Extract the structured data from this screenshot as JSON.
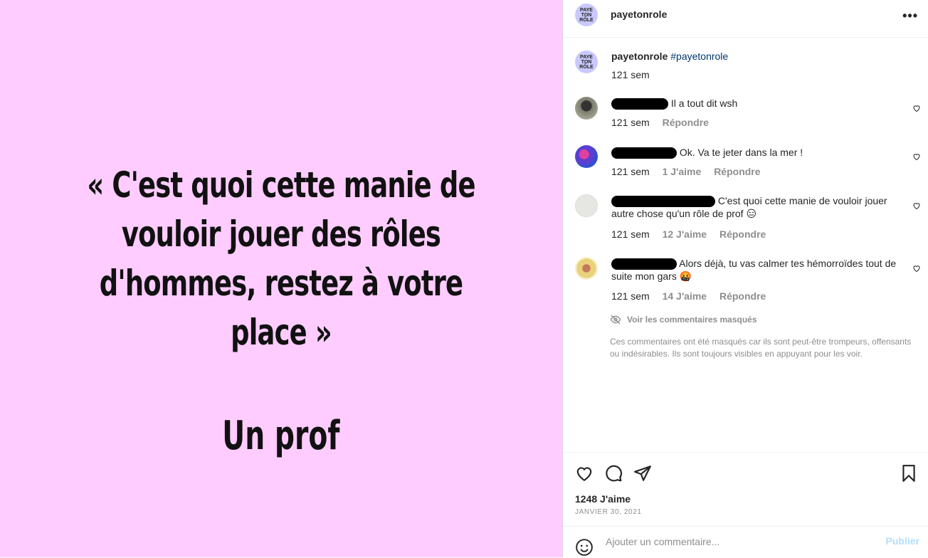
{
  "post": {
    "quote": "« C'est quoi cette manie de vouloir jouer des rôles d'hommes, restez à votre place »",
    "author": "Un prof"
  },
  "header": {
    "username": "payetonrole",
    "more_label": "•••",
    "logo_text": "PAYE TON RÔLE"
  },
  "caption": {
    "username": "payetonrole",
    "hashtag": "#payetonrole",
    "time": "121 sem"
  },
  "comments": [
    {
      "text": "Il a tout dit wsh",
      "time": "121 sem",
      "likes": "",
      "reply": "Répondre"
    },
    {
      "text": "Ok. Va te jeter dans la mer !",
      "time": "121 sem",
      "likes": "1 J'aime",
      "reply": "Répondre"
    },
    {
      "text": "C'est quoi cette manie de vouloir jouer autre chose qu'un rôle de prof 😑",
      "time": "121 sem",
      "likes": "12 J'aime",
      "reply": "Répondre"
    },
    {
      "text": "Alors déjà, tu vas calmer tes hémorroïdes tout de suite mon gars 🤬",
      "time": "121 sem",
      "likes": "14 J'aime",
      "reply": "Répondre"
    }
  ],
  "hidden": {
    "link": "Voir les commentaires masqués",
    "note": "Ces commentaires ont été masqués car ils sont peut-être trompeurs, offensants ou indésirables. Ils sont toujours visibles en appuyant pour les voir."
  },
  "stats": {
    "likes": "1248 J'aime",
    "date": "JANVIER 30, 2021"
  },
  "composer": {
    "placeholder": "Ajouter un commentaire...",
    "publish": "Publier"
  },
  "colors": {
    "post_bg": "#ffccff",
    "link": "#00376b",
    "publish_disabled": "#b2dffc"
  }
}
